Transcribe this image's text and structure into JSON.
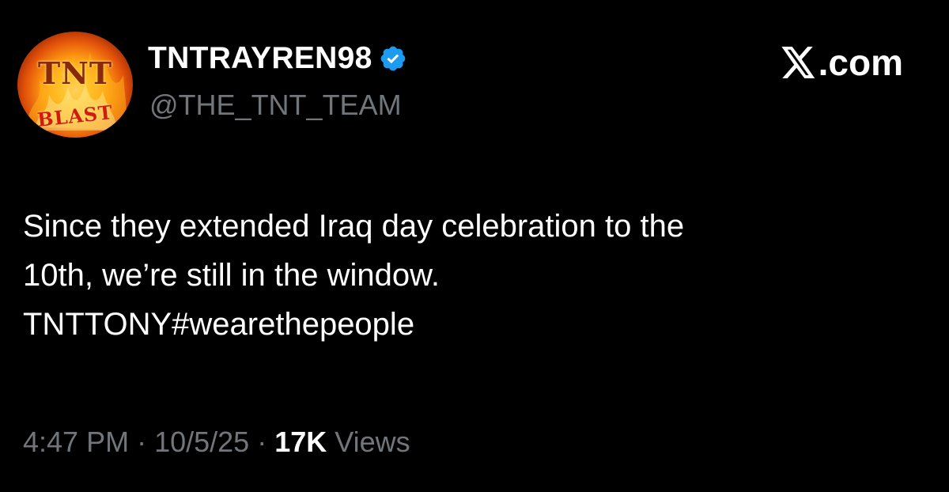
{
  "author": {
    "display_name": "TNTRAYREN98",
    "handle": "@THE_TNT_TEAM",
    "verified": true,
    "avatar": {
      "top_text": "TNT",
      "bottom_text": "BLAST"
    }
  },
  "source": {
    "label": ".com",
    "icon": "x-logo-icon"
  },
  "tweet": {
    "lines": [
      "Since they extended Iraq day celebration to the",
      "10th, we’re still in the window.",
      "TNTTONY#wearethepeople"
    ]
  },
  "meta": {
    "time": "4:47 PM",
    "sep1": " · ",
    "date": "10/5/25",
    "sep2": " · ",
    "views_count": "17K",
    "views_label": " Views"
  },
  "colors": {
    "background": "#000000",
    "text_primary": "#ffffff",
    "text_secondary": "#71767b",
    "verified_blue": "#1d9bf0"
  }
}
